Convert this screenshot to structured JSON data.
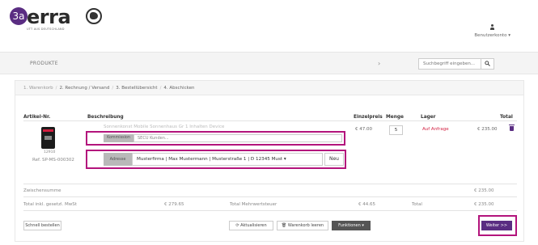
{
  "step_badge": "3a",
  "logo": {
    "text": "erra",
    "sub": "UTT AUS DEUTSCHLAND"
  },
  "user": {
    "label": "Benutzerkonto ▾"
  },
  "nav": {
    "products": "PRODUKTE",
    "chevron": "›"
  },
  "search": {
    "placeholder": "Suchbegriff eingeben..."
  },
  "breadcrumb": {
    "steps": [
      "1. Warenkorb",
      "2. Rechnung / Versand",
      "3. Bestellübersicht",
      "4. Abschicken"
    ],
    "separator": "/"
  },
  "table": {
    "headers": {
      "article": "Artikel-Nr.",
      "description": "Beschreibung",
      "unit_price": "Einzelpreis",
      "quantity": "Menge",
      "stock": "Lager",
      "total": "Total"
    },
    "row": {
      "image_code": "12910",
      "article_no": "Ref. SP-MS-000302",
      "title": "Sonnenkonst Mobile Sonnenhaus Gr 1 Inhalten Device",
      "kommission_label": "Kommission",
      "kommission_value": "SECU Kunden...",
      "adresse_label": "Adresse",
      "adresse_value": "Musterfirma | Max Mustermann | Musterstraße 1 | D 12345 Must ▾",
      "neu_label": "Neu",
      "unit_price": "€ 47.00",
      "quantity": "5",
      "stock": "Auf Anfrage",
      "total": "€ 235.00"
    }
  },
  "totals": {
    "subtotal_label": "Zwischensumme",
    "subtotal_value": "€ 235.00",
    "net_label": "Total inkl. gesetzl. MwSt",
    "net_value": "€ 279.65",
    "vat_label": "Total Mehrwertsteuer",
    "vat_value": "€ 44.65",
    "grand_label": "Total",
    "grand_value": "€ 235.00"
  },
  "actions": {
    "quick_order": "Schnell bestellen",
    "refresh": "⟳ Aktualisieren",
    "clear_cart": "🗑 Warenkorb leeren",
    "functions": "Funktionen ▾",
    "next": "Weiter >>"
  },
  "colors": {
    "accent": "#5a2d82",
    "highlight": "#b3147c",
    "stock": "#d21d3f"
  }
}
